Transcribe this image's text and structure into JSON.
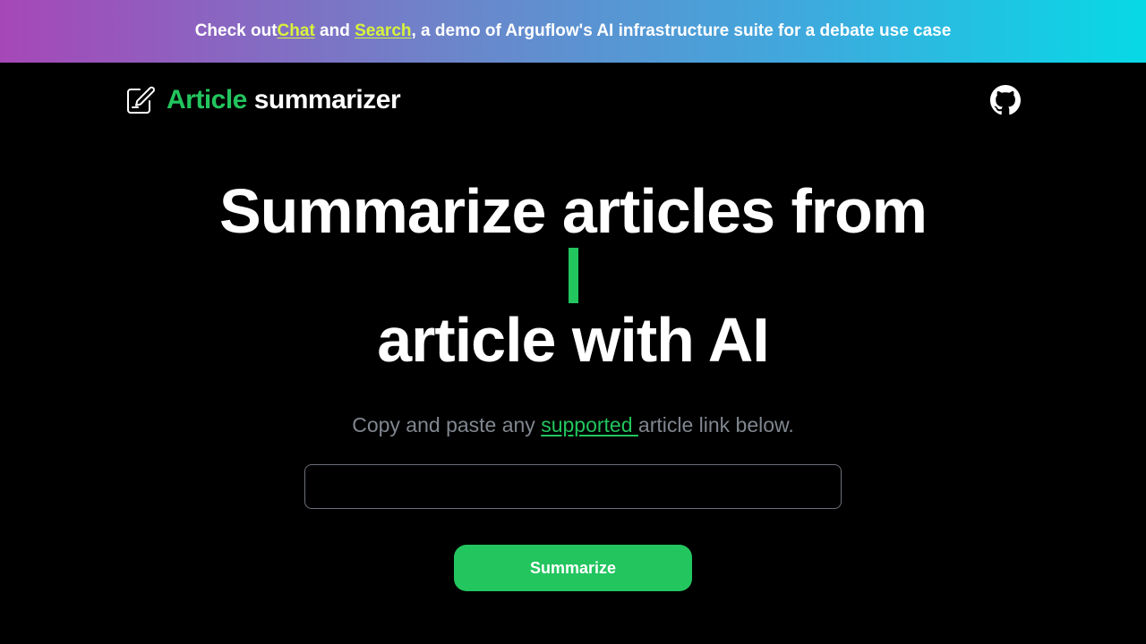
{
  "banner": {
    "prefix": "Check out ",
    "link_chat": "Chat",
    "middle": " and ",
    "link_search": "Search",
    "suffix": ", a demo of Arguflow's AI infrastructure suite for a debate use case"
  },
  "nav": {
    "logo_icon": "edit-note-icon",
    "logo_accent": "Article",
    "logo_rest": " summarizer",
    "github_icon": "github-icon"
  },
  "hero": {
    "line1": "Summarize articles from",
    "line3": "article with AI"
  },
  "subtitle": {
    "prefix": "Copy and paste any ",
    "link": "supported ",
    "suffix": "article link below."
  },
  "form": {
    "input_value": "",
    "button_label": "Summarize"
  },
  "colors": {
    "accent": "#22c55e",
    "banner_link": "#d9f33a",
    "background": "#000000",
    "muted_text": "#80868f"
  }
}
